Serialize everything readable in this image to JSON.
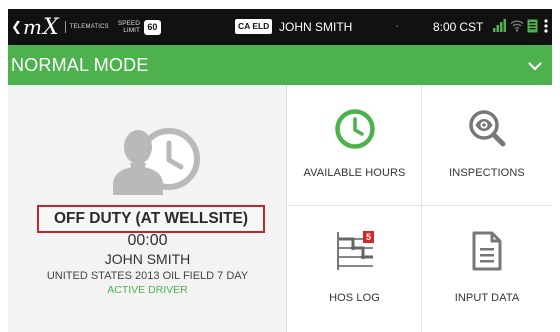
{
  "status_bar": {
    "logo_text": "mix",
    "telematics_label": "TELEMATICS",
    "speed_label_line1": "SPEED",
    "speed_label_line2": "LIMIT",
    "speed_limit": "60",
    "eld_badge": "CA ELD",
    "driver_name": "JOHN SMITH",
    "time": "8:00",
    "timezone": "CST",
    "icons": [
      "back-chevron-icon",
      "signal-icon",
      "wifi-icon",
      "device-icon",
      "kebab-menu-icon"
    ],
    "signal_color": "#4db24d"
  },
  "mode_bar": {
    "label": "NORMAL MODE",
    "background": "#4db24d",
    "icon": "chevron-down-icon"
  },
  "driver_panel": {
    "status": "OFF DUTY (AT WELLSITE)",
    "status_border_color": "#c0272d",
    "timer": "00:00",
    "driver_name": "JOHN SMITH",
    "ruleset": "UNITED STATES 2013 OIL FIELD 7 DAY",
    "driver_role": "ACTIVE DRIVER",
    "driver_role_color": "#4db24d"
  },
  "tiles": [
    {
      "label": "AVAILABLE HOURS",
      "icon": "clock-icon",
      "icon_color": "#4db24d"
    },
    {
      "label": "INSPECTIONS",
      "icon": "magnifier-eye-icon",
      "icon_color": "#777777"
    },
    {
      "label": "HOS LOG",
      "icon": "hos-log-icon",
      "badge": "5",
      "badge_color": "#d02929"
    },
    {
      "label": "INPUT DATA",
      "icon": "document-icon",
      "icon_color": "#777777"
    }
  ]
}
